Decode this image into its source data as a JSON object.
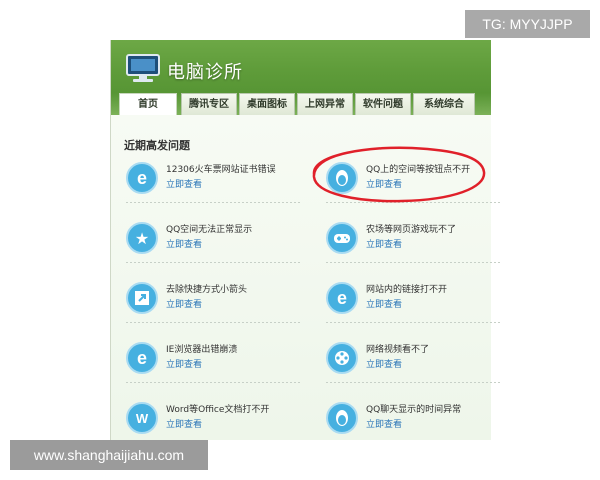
{
  "watermark_top": "TG: MYYJJPP",
  "watermark_bottom": "www.shanghaijiahu.com",
  "app": {
    "title": "电脑诊所"
  },
  "tabs": [
    {
      "label": "首页"
    },
    {
      "label": "腾讯专区"
    },
    {
      "label": "桌面图标"
    },
    {
      "label": "上网异常"
    },
    {
      "label": "软件问题"
    },
    {
      "label": "系统综合"
    }
  ],
  "section": {
    "title": "近期高发问题"
  },
  "link_text": "立即查看",
  "items": [
    {
      "label": "12306火车票网站证书错误",
      "icon": "ie-icon"
    },
    {
      "label": "QQ上的空间等按钮点不开",
      "icon": "qq-penguin-icon"
    },
    {
      "label": "QQ空间无法正常显示",
      "icon": "qzone-star-icon"
    },
    {
      "label": "农场等网页游戏玩不了",
      "icon": "gamepad-icon"
    },
    {
      "label": "去除快捷方式小箭头",
      "icon": "shortcut-arrow-icon"
    },
    {
      "label": "网站内的链接打不开",
      "icon": "ie-icon"
    },
    {
      "label": "IE浏览器出错崩溃",
      "icon": "ie-icon"
    },
    {
      "label": "网络视频看不了",
      "icon": "film-reel-icon"
    },
    {
      "label": "Word等Office文档打不开",
      "icon": "word-icon"
    },
    {
      "label": "QQ聊天显示的时间异常",
      "icon": "qq-penguin-icon"
    }
  ],
  "colors": {
    "header_green": "#5f9c3a",
    "icon_blue": "#46b0e0",
    "link_blue": "#2b76b8",
    "annotation_red": "#e0202a"
  }
}
